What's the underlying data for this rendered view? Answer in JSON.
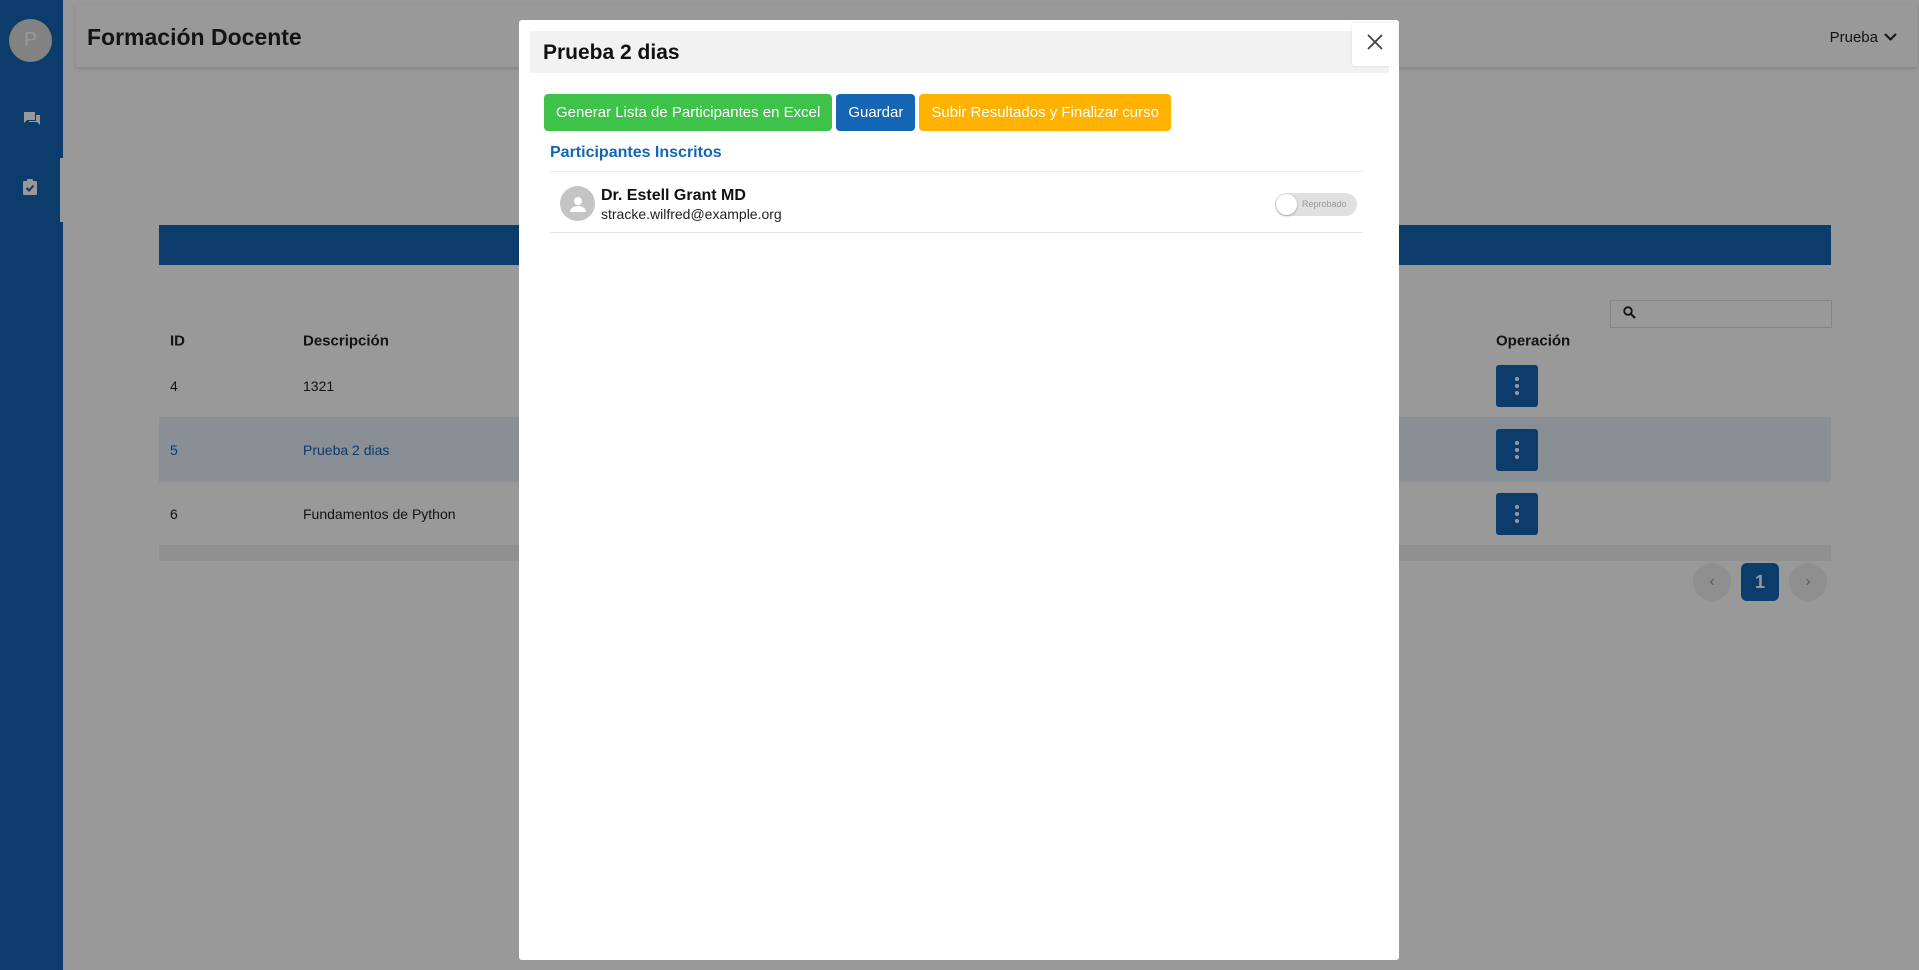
{
  "sidebar": {
    "avatar_letter": "P",
    "items": [
      {
        "icon": "chat-icon"
      },
      {
        "icon": "clipboard-check-icon",
        "active": true
      }
    ]
  },
  "header": {
    "title": "Formación Docente",
    "user": "Prueba"
  },
  "table": {
    "columns": {
      "id": "ID",
      "description": "Descripción",
      "operation": "Operación"
    },
    "rows": [
      {
        "id": "4",
        "description": "1321"
      },
      {
        "id": "5",
        "description": "Prueba 2 dias",
        "selected": true
      },
      {
        "id": "6",
        "description": "Fundamentos de Python"
      }
    ]
  },
  "pagination": {
    "current": "1"
  },
  "modal": {
    "title": "Prueba 2 dias",
    "buttons": {
      "excel": "Generar Lista de Participantes en Excel",
      "save": "Guardar",
      "finalize": "Subir Resultados y Finalizar curso"
    },
    "section_title": "Participantes Inscritos",
    "participants": [
      {
        "name": "Dr. Estell Grant MD",
        "email": "stracke.wilfred@example.org",
        "status": "Reprobado",
        "approved": false
      }
    ]
  },
  "colors": {
    "primary": "#1565b5",
    "success": "#3fc24a",
    "warning": "#ffb300"
  }
}
